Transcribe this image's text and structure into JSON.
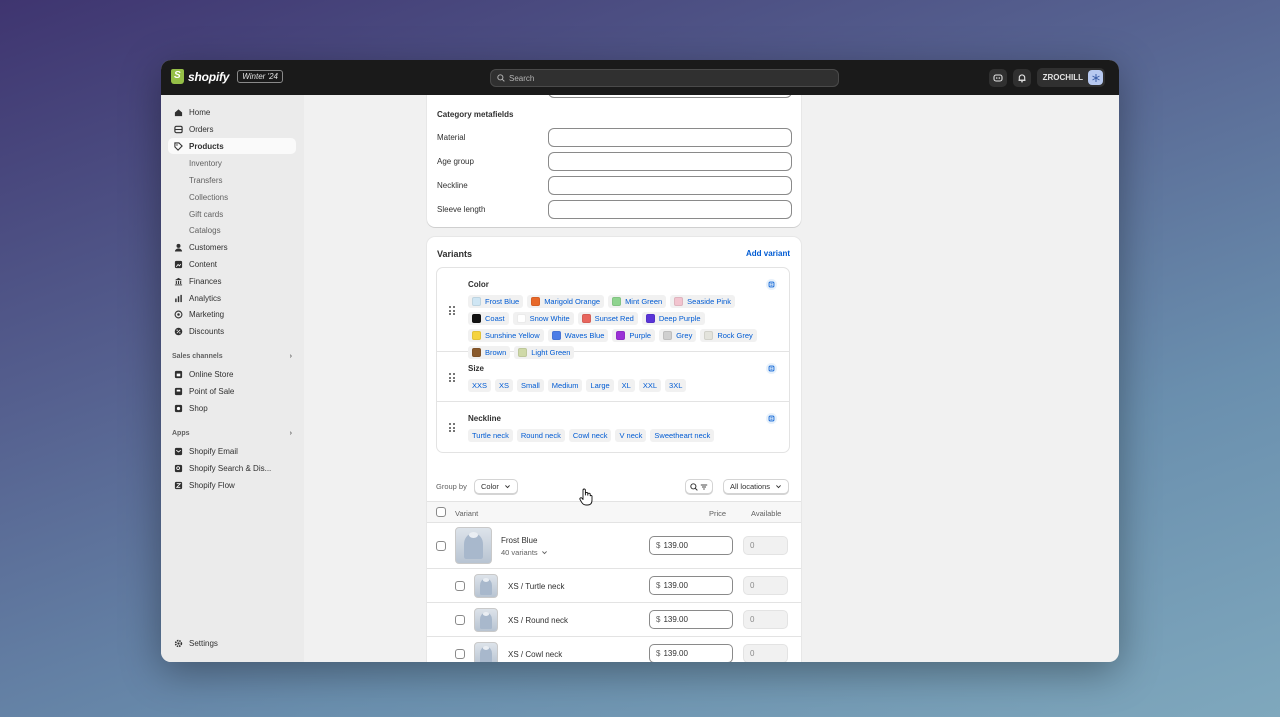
{
  "topbar": {
    "brand": "shopify",
    "badge": "Winter '24",
    "search_placeholder": "Search",
    "store_name": "ZROCHILL"
  },
  "sidebar": {
    "items": [
      {
        "label": "Home",
        "icon": "home-icon"
      },
      {
        "label": "Orders",
        "icon": "orders-icon"
      },
      {
        "label": "Products",
        "icon": "tag-icon",
        "active": true
      },
      {
        "label": "Customers",
        "icon": "person-icon"
      },
      {
        "label": "Content",
        "icon": "content-icon"
      },
      {
        "label": "Finances",
        "icon": "bank-icon"
      },
      {
        "label": "Analytics",
        "icon": "bar-chart-icon"
      },
      {
        "label": "Marketing",
        "icon": "target-icon"
      },
      {
        "label": "Discounts",
        "icon": "discount-icon"
      }
    ],
    "product_subitems": [
      "Inventory",
      "Transfers",
      "Collections",
      "Gift cards",
      "Catalogs"
    ],
    "sales_channels_label": "Sales channels",
    "sales_channels": [
      "Online Store",
      "Point of Sale",
      "Shop"
    ],
    "apps_label": "Apps",
    "apps": [
      "Shopify Email",
      "Shopify Search & Dis...",
      "Shopify Flow"
    ],
    "settings_label": "Settings"
  },
  "metafields": {
    "title": "Category metafields",
    "fields": [
      "Material",
      "Age group",
      "Neckline",
      "Sleeve length"
    ]
  },
  "variants": {
    "title": "Variants",
    "add_label": "Add variant",
    "options": [
      {
        "name": "Color",
        "values": [
          {
            "label": "Frost Blue",
            "color": "#cfe6f4"
          },
          {
            "label": "Marigold Orange",
            "color": "#e8692a"
          },
          {
            "label": "Mint Green",
            "color": "#8fd48f"
          },
          {
            "label": "Seaside Pink",
            "color": "#f2c4cf"
          },
          {
            "label": "Coast",
            "color": "#111111"
          },
          {
            "label": "Snow White",
            "color": "#ffffff"
          },
          {
            "label": "Sunset Red",
            "color": "#e8665e"
          },
          {
            "label": "Deep Purple",
            "color": "#5a35d8"
          },
          {
            "label": "Sunshine Yellow",
            "color": "#f5d33f"
          },
          {
            "label": "Waves Blue",
            "color": "#4c7de6"
          },
          {
            "label": "Purple",
            "color": "#9b30d6"
          },
          {
            "label": "Grey",
            "color": "#cfcfcf"
          },
          {
            "label": "Rock Grey",
            "color": "#e3e3dc"
          },
          {
            "label": "Brown",
            "color": "#8a5a2c"
          },
          {
            "label": "Light Green",
            "color": "#cfd9a8"
          }
        ]
      },
      {
        "name": "Size",
        "values": [
          {
            "label": "XXS"
          },
          {
            "label": "XS"
          },
          {
            "label": "Small"
          },
          {
            "label": "Medium"
          },
          {
            "label": "Large"
          },
          {
            "label": "XL"
          },
          {
            "label": "XXL"
          },
          {
            "label": "3XL"
          }
        ]
      },
      {
        "name": "Neckline",
        "values": [
          {
            "label": "Turtle neck"
          },
          {
            "label": "Round neck"
          },
          {
            "label": "Cowl neck"
          },
          {
            "label": "V neck"
          },
          {
            "label": "Sweetheart neck"
          }
        ]
      }
    ],
    "group_by_label": "Group by",
    "group_by_value": "Color",
    "locations_value": "All locations",
    "columns": {
      "variant": "Variant",
      "price": "Price",
      "available": "Available"
    },
    "group_row": {
      "name": "Frost Blue",
      "count": "40 variants",
      "currency": "$",
      "price": "139.00",
      "available": "0"
    },
    "rows": [
      {
        "name": "XS / Turtle neck",
        "currency": "$",
        "price": "139.00",
        "available": "0"
      },
      {
        "name": "XS / Round neck",
        "currency": "$",
        "price": "139.00",
        "available": "0"
      },
      {
        "name": "XS / Cowl neck",
        "currency": "$",
        "price": "139.00",
        "available": "0"
      }
    ]
  }
}
